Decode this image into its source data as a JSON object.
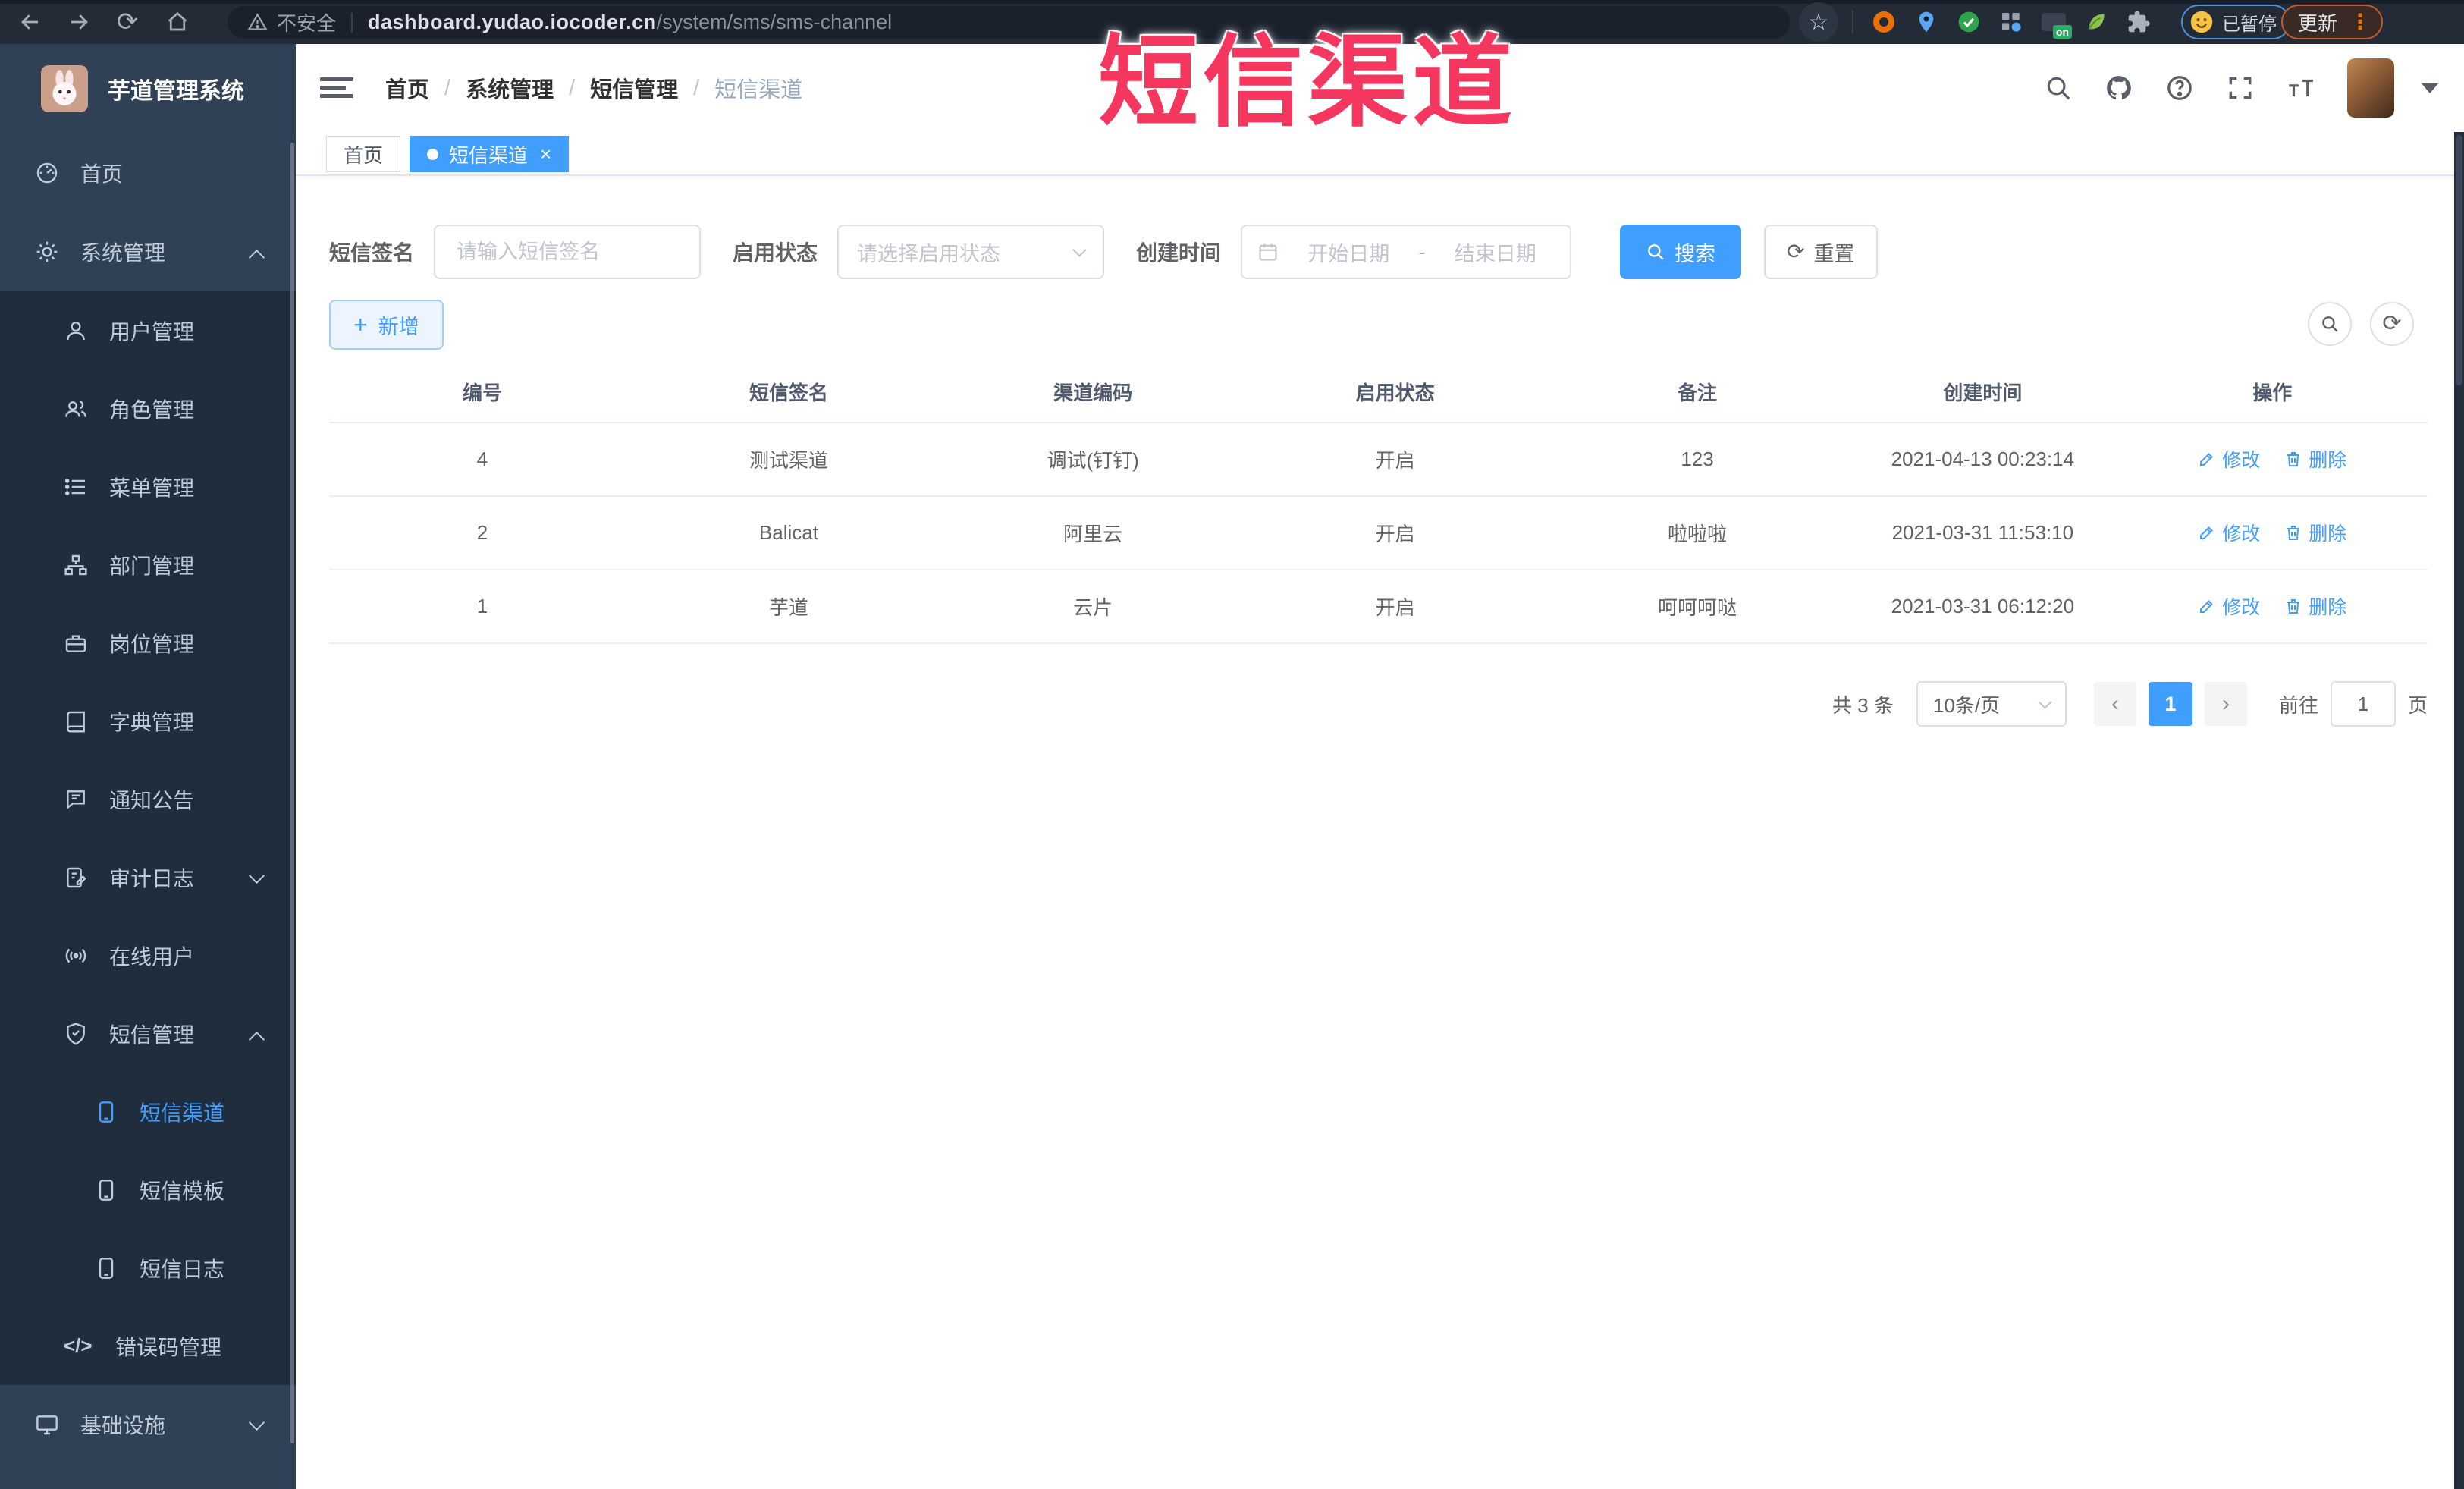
{
  "browser": {
    "not_secure": "不安全",
    "url_host": "dashboard.yudao.iocoder.cn",
    "url_path": "/system/sms/sms-channel",
    "ext_on_badge": "on",
    "profile_status": "已暂停",
    "update_label": "更新"
  },
  "glyphs": {
    "star": "☆",
    "close": "×",
    "reload": "⟳",
    "plus": "+",
    "prev": "‹",
    "next": "›",
    "dots": "⋮",
    "code": "</>"
  },
  "overlay_title": "短信渠道",
  "sidebar": {
    "title": "芋道管理系统",
    "items": [
      {
        "label": "首页"
      },
      {
        "label": "系统管理"
      },
      {
        "label": "用户管理"
      },
      {
        "label": "角色管理"
      },
      {
        "label": "菜单管理"
      },
      {
        "label": "部门管理"
      },
      {
        "label": "岗位管理"
      },
      {
        "label": "字典管理"
      },
      {
        "label": "通知公告"
      },
      {
        "label": "审计日志"
      },
      {
        "label": "在线用户"
      },
      {
        "label": "短信管理"
      },
      {
        "label": "短信渠道"
      },
      {
        "label": "短信模板"
      },
      {
        "label": "短信日志"
      },
      {
        "label": "错误码管理"
      },
      {
        "label": "基础设施"
      }
    ]
  },
  "breadcrumb": {
    "sep": "/",
    "items": [
      {
        "label": "首页"
      },
      {
        "label": "系统管理"
      },
      {
        "label": "短信管理"
      },
      {
        "label": "短信渠道"
      }
    ]
  },
  "tabs": [
    {
      "label": "首页"
    },
    {
      "label": "短信渠道"
    }
  ],
  "filters": {
    "signature_label": "短信签名",
    "signature_placeholder": "请输入短信签名",
    "status_label": "启用状态",
    "status_placeholder": "请选择启用状态",
    "time_label": "创建时间",
    "start_placeholder": "开始日期",
    "range_separator": "-",
    "end_placeholder": "结束日期",
    "search_label": "搜索",
    "reset_label": "重置"
  },
  "toolbar": {
    "add_label": "新增"
  },
  "table": {
    "headers": [
      "编号",
      "短信签名",
      "渠道编码",
      "启用状态",
      "备注",
      "创建时间",
      "操作"
    ],
    "rows": [
      {
        "id": "4",
        "signature": "测试渠道",
        "code": "调试(钉钉)",
        "status": "开启",
        "remark": "123",
        "created": "2021-04-13 00:23:14"
      },
      {
        "id": "2",
        "signature": "Balicat",
        "code": "阿里云",
        "status": "开启",
        "remark": "啦啦啦",
        "created": "2021-03-31 11:53:10"
      },
      {
        "id": "1",
        "signature": "芋道",
        "code": "云片",
        "status": "开启",
        "remark": "呵呵呵哒",
        "created": "2021-03-31 06:12:20"
      }
    ],
    "edit_label": "修改",
    "delete_label": "删除"
  },
  "pagination": {
    "total_label": "共 3 条",
    "page_size": "10条/页",
    "current_page": "1",
    "goto_label": "前往",
    "goto_value": "1",
    "page_unit": "页"
  },
  "colors": {
    "accent": "#409EFF",
    "overlay_red": "#f5365f",
    "sidebar_bg": "#304156",
    "submenu_bg": "#1f2d3d",
    "toolbar_dark": "#222b36"
  }
}
